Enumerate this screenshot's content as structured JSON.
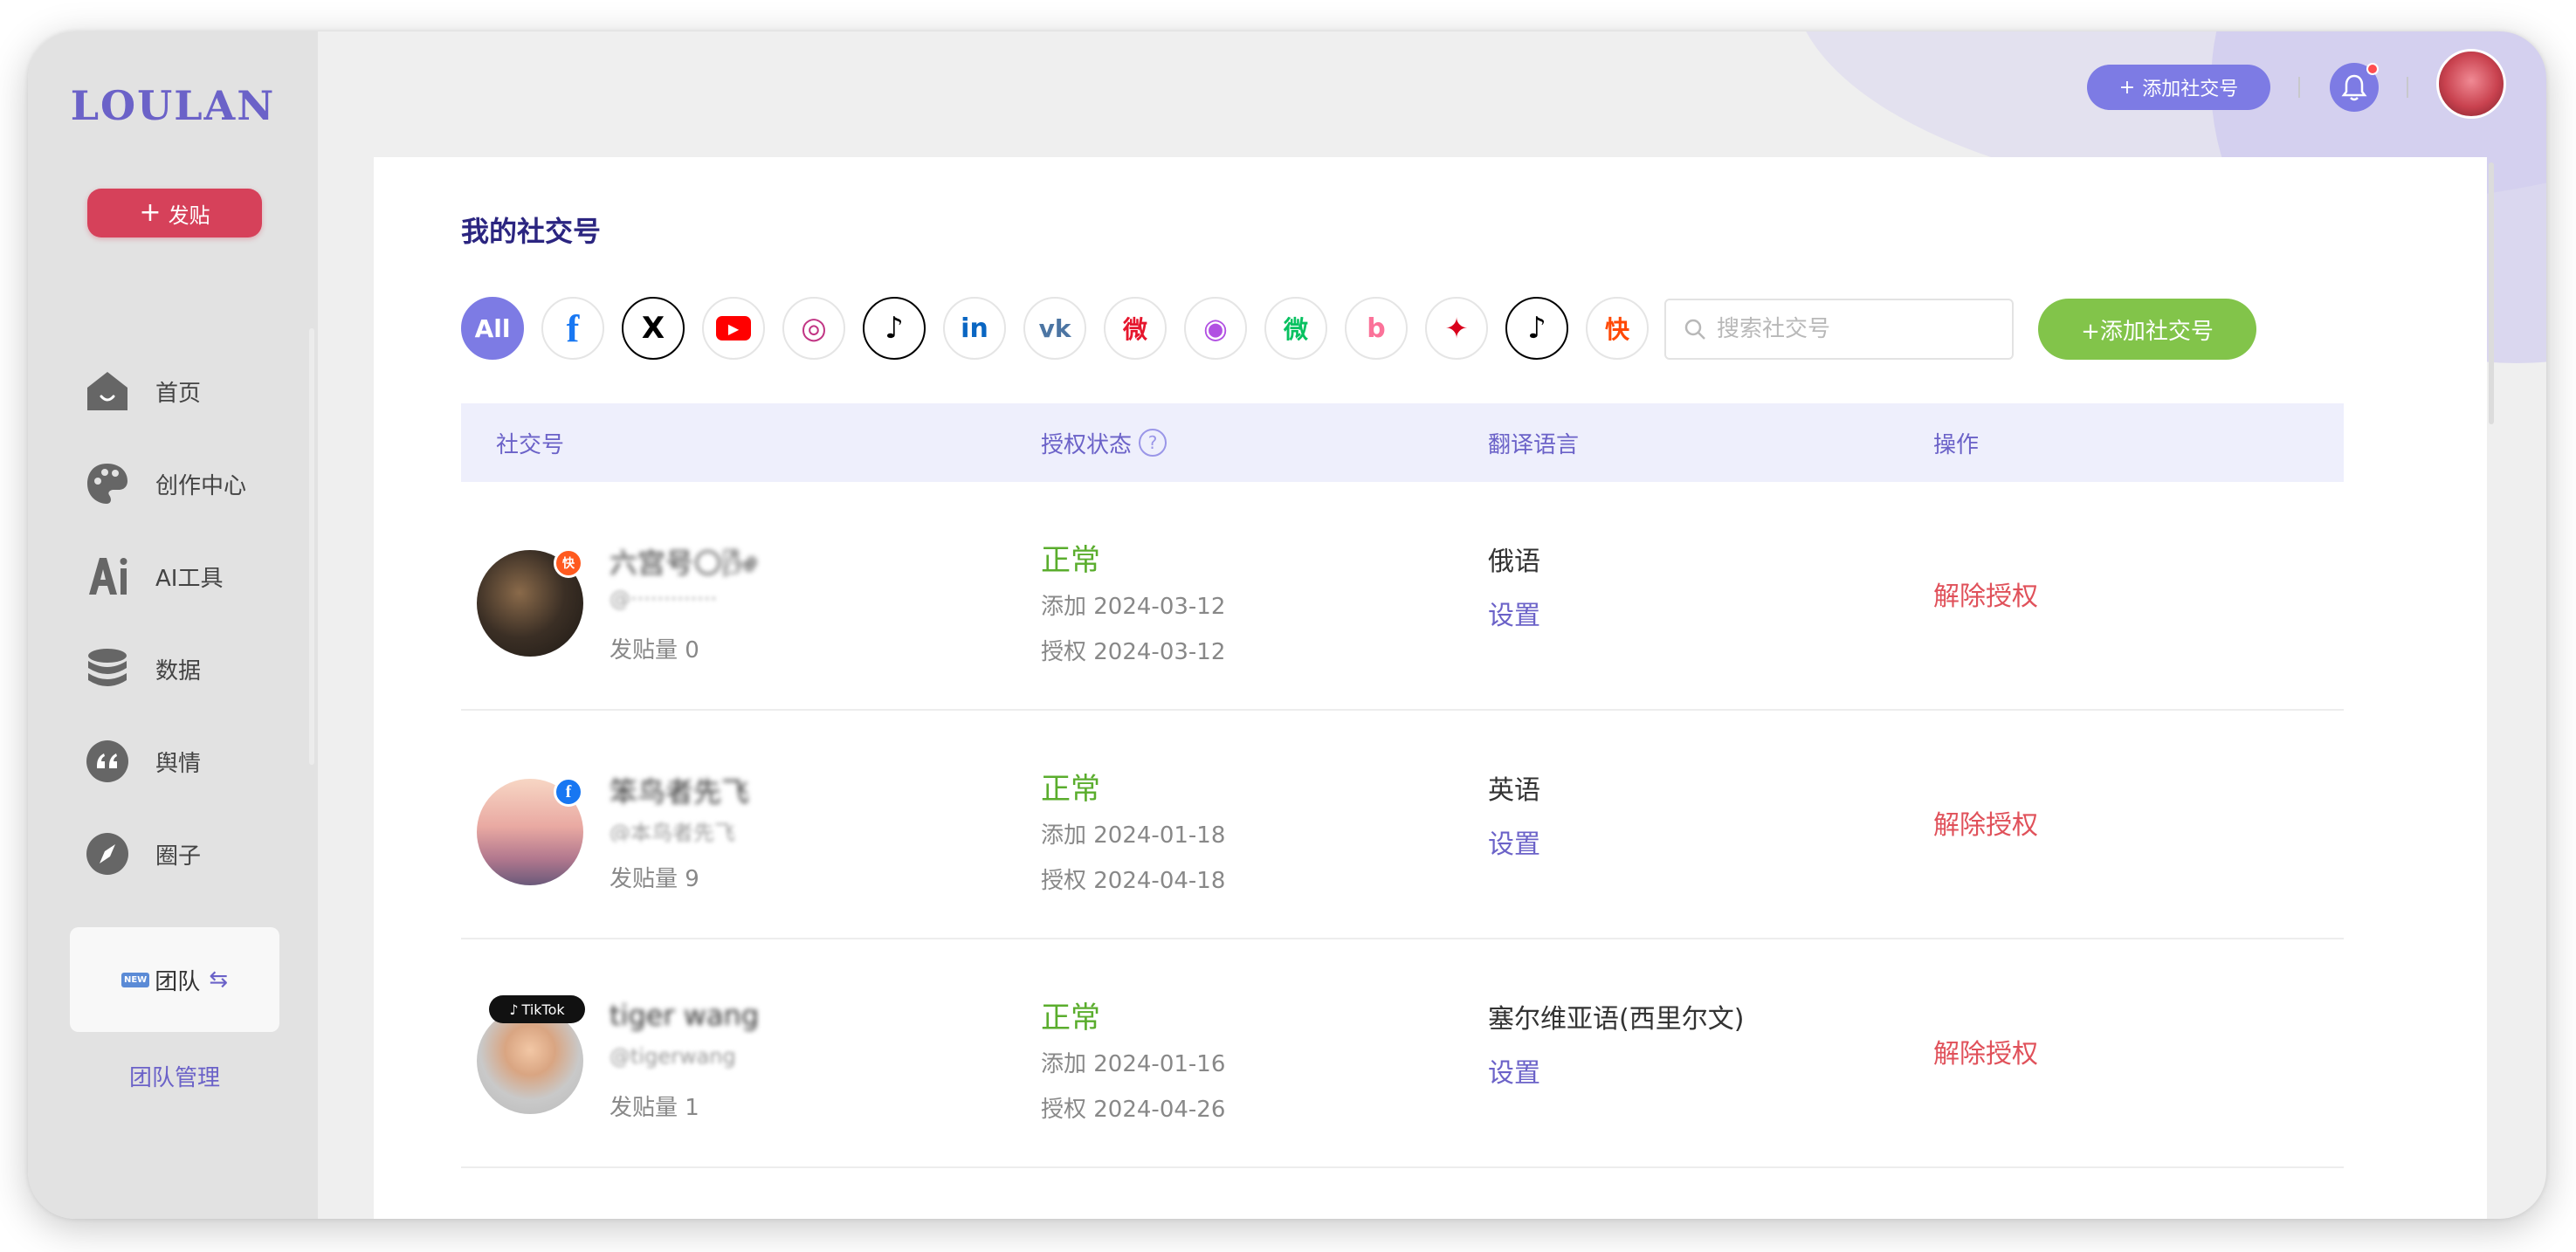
{
  "sidebar": {
    "logo": "LOULAN",
    "post_label": "发贴",
    "nav": [
      "首页",
      "创作中心",
      "AI工具",
      "数据",
      "舆情",
      "圈子"
    ],
    "team_new_badge": "NEW",
    "team_label": "团队",
    "team_manage": "团队管理"
  },
  "topbar": {
    "add_label": "添加社交号"
  },
  "main": {
    "title": "我的社交号",
    "platforms": {
      "all": "All",
      "facebook": "f",
      "x": "X",
      "youtube": "▶",
      "instagram": "◎",
      "tiktok": "♪",
      "linkedin": "in",
      "vk": "vk",
      "weibo": "微",
      "podcast": "◉",
      "wechat": "微",
      "bilibili": "b",
      "douyin_red": "✦",
      "tiktok2": "♪",
      "kuaishou": "快"
    },
    "search_placeholder": "搜索社交号",
    "add_label": "+添加社交号",
    "columns": {
      "account": "社交号",
      "status": "授权状态",
      "status_help": "?",
      "language": "翻译语言",
      "action": "操作"
    },
    "rows": [
      {
        "name": "六宫号🌕🌬",
        "handle": "@·············",
        "posts": "发贴量 0",
        "status": "正常",
        "added": "添加 2024-03-12",
        "authed": "授权 2024-03-12",
        "language": "俄语",
        "setting": "设置",
        "action": "解除授权"
      },
      {
        "name": "笨鸟者先飞",
        "handle": "@本鸟者先飞",
        "posts": "发贴量 9",
        "status": "正常",
        "added": "添加 2024-01-18",
        "authed": "授权 2024-04-18",
        "language": "英语",
        "setting": "设置",
        "action": "解除授权"
      },
      {
        "name": "tiger wang",
        "handle": "@tigerwang",
        "posts": "发贴量 1",
        "tiktok_badge": "TikTok",
        "status": "正常",
        "added": "添加 2024-01-16",
        "authed": "授权 2024-04-26",
        "language": "塞尔维亚语(西里尔文)",
        "setting": "设置",
        "action": "解除授权"
      }
    ]
  },
  "colors": {
    "accent": "#7d7be4",
    "post_button": "#d6415a",
    "add_green": "#82c44a",
    "status_ok": "#5aad2d",
    "revoke": "#e0515a"
  }
}
